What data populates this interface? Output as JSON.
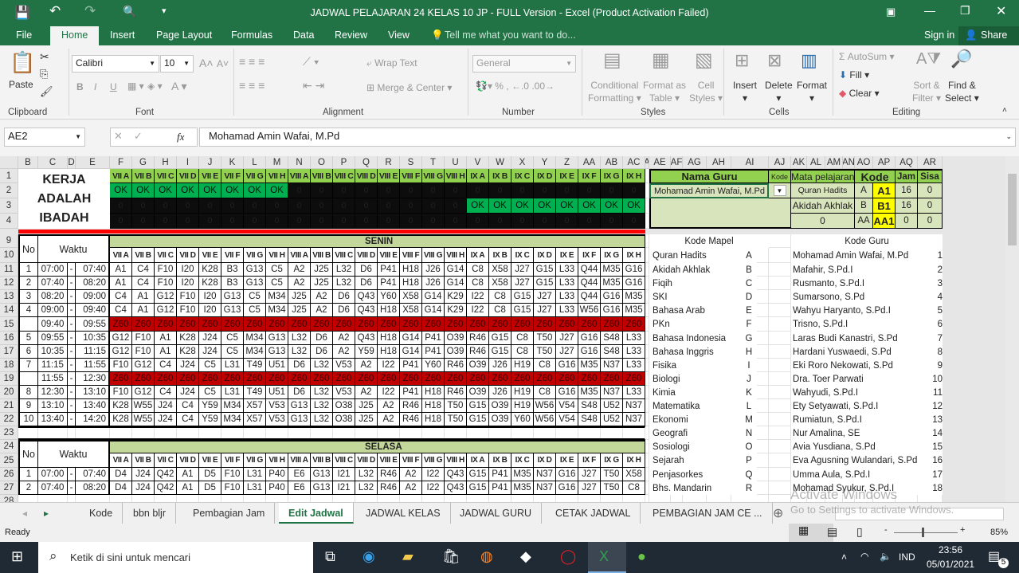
{
  "window": {
    "title": "JADWAL PELAJARAN 24 KELAS 10 JP - FULL Version - Excel (Product Activation Failed)"
  },
  "ribbon_tabs": {
    "file": "File",
    "home": "Home",
    "insert": "Insert",
    "page_layout": "Page Layout",
    "formulas": "Formulas",
    "data": "Data",
    "review": "Review",
    "view": "View",
    "tell_me": "Tell me what you want to do...",
    "sign_in": "Sign in",
    "share": "Share",
    "active": "Home"
  },
  "ribbon": {
    "clipboard": {
      "label": "Clipboard",
      "paste": "Paste"
    },
    "font": {
      "label": "Font",
      "name": "Calibri",
      "size": "10",
      "bold": "B",
      "italic": "I",
      "underline": "U"
    },
    "alignment": {
      "label": "Alignment",
      "wrap_text": "Wrap Text",
      "merge_center": "Merge & Center"
    },
    "number": {
      "label": "Number",
      "format": "General"
    },
    "styles": {
      "label": "Styles",
      "conditional": "Conditional",
      "formatting": "Formatting",
      "format_as": "Format as",
      "table": "Table",
      "cell": "Cell",
      "styles": "Styles"
    },
    "cells": {
      "label": "Cells",
      "insert": "Insert",
      "delete": "Delete",
      "format": "Format"
    },
    "editing": {
      "label": "Editing",
      "autosum": "AutoSum",
      "fill": "Fill",
      "clear": "Clear",
      "sort": "Sort &",
      "filter": "Filter",
      "find": "Find &",
      "select": "Select"
    }
  },
  "formula_bar": {
    "name_box": "AE2",
    "fx": "fx",
    "value": "Mohamad Amin Wafai, M.Pd"
  },
  "column_headers": [
    "B",
    "C",
    "D",
    "E",
    "F",
    "G",
    "H",
    "I",
    "J",
    "K",
    "L",
    "M",
    "N",
    "O",
    "P",
    "Q",
    "R",
    "S",
    "T",
    "U",
    "V",
    "W",
    "X",
    "Y",
    "Z",
    "AA",
    "AB",
    "AC",
    "A",
    "AE",
    "AF",
    "AG",
    "AH",
    "AI",
    "AJ",
    "AK",
    "AL",
    "AM",
    "AN",
    "AO",
    "AP",
    "AQ",
    "AR"
  ],
  "row_headers": [
    "1",
    "2",
    "3",
    "4",
    "9",
    "10",
    "11",
    "12",
    "13",
    "14",
    "15",
    "16",
    "17",
    "18",
    "19",
    "20",
    "21",
    "22",
    "23",
    "24",
    "25",
    "26",
    "27",
    "28"
  ],
  "motto": [
    "KERJA",
    "ADALAH",
    "IBADAH"
  ],
  "classes": [
    "VII A",
    "VII B",
    "VII C",
    "VII D",
    "VII E",
    "VII F",
    "VII G",
    "VII H",
    "VIII A",
    "VIII B",
    "VIII C",
    "VIII D",
    "VIII E",
    "VIII F",
    "VIII G",
    "VIII H",
    "IX A",
    "IX B",
    "IX C",
    "IX D",
    "IX E",
    "IX F",
    "IX G",
    "IX H"
  ],
  "status_rows": [
    [
      "OK",
      "OK",
      "OK",
      "OK",
      "OK",
      "OK",
      "OK",
      "OK",
      "0",
      "0",
      "0",
      "0",
      "0",
      "0",
      "0",
      "0",
      "0",
      "0",
      "0",
      "0",
      "0",
      "0",
      "0",
      "0"
    ],
    [
      "0",
      "0",
      "0",
      "0",
      "0",
      "0",
      "0",
      "0",
      "0",
      "0",
      "0",
      "0",
      "0",
      "0",
      "0",
      "0",
      "OK",
      "OK",
      "OK",
      "OK",
      "OK",
      "OK",
      "OK",
      "OK"
    ],
    [
      "0",
      "0",
      "0",
      "0",
      "0",
      "0",
      "0",
      "0",
      "0",
      "0",
      "0",
      "0",
      "0",
      "0",
      "0",
      "0",
      "0",
      "0",
      "0",
      "0",
      "0",
      "0",
      "0",
      "0"
    ]
  ],
  "colors": {
    "header_green": "#92d050",
    "ok_green": "#00b050",
    "black": "#0d0d0d",
    "day_band": "#c4d79b",
    "break_red": "#c00000",
    "panel_green": "#d8e4bc",
    "code_yellow": "#ffff00",
    "excel_green": "#217346"
  },
  "labels": {
    "no": "No",
    "waktu": "Waktu",
    "dash": "-"
  },
  "senin": {
    "day": "SENIN",
    "rows": [
      {
        "no": "1",
        "start": "07:00",
        "end": "07:40",
        "cells": [
          "A1",
          "C4",
          "F10",
          "I20",
          "K28",
          "B3",
          "G13",
          "C5",
          "A2",
          "J25",
          "L32",
          "D6",
          "P41",
          "H18",
          "J26",
          "G14",
          "C8",
          "X58",
          "J27",
          "G15",
          "L33",
          "Q44",
          "M35",
          "G16"
        ]
      },
      {
        "no": "2",
        "start": "07:40",
        "end": "08:20",
        "cells": [
          "A1",
          "C4",
          "F10",
          "I20",
          "K28",
          "B3",
          "G13",
          "C5",
          "A2",
          "J25",
          "L32",
          "D6",
          "P41",
          "H18",
          "J26",
          "G14",
          "C8",
          "X58",
          "J27",
          "G15",
          "L33",
          "Q44",
          "M35",
          "G16"
        ]
      },
      {
        "no": "3",
        "start": "08:20",
        "end": "09:00",
        "cells": [
          "C4",
          "A1",
          "G12",
          "F10",
          "I20",
          "G13",
          "C5",
          "M34",
          "J25",
          "A2",
          "D6",
          "Q43",
          "Y60",
          "X58",
          "G14",
          "K29",
          "I22",
          "C8",
          "G15",
          "J27",
          "L33",
          "Q44",
          "G16",
          "M35"
        ]
      },
      {
        "no": "4",
        "start": "09:00",
        "end": "09:40",
        "cells": [
          "C4",
          "A1",
          "G12",
          "F10",
          "I20",
          "G13",
          "C5",
          "M34",
          "J25",
          "A2",
          "D6",
          "Q43",
          "H18",
          "X58",
          "G14",
          "K29",
          "I22",
          "C8",
          "G15",
          "J27",
          "L33",
          "W56",
          "G16",
          "M35"
        ]
      },
      {
        "no": "",
        "start": "09:40",
        "end": "09:55",
        "break": true,
        "cells": [
          "Z60",
          "Z60",
          "Z60",
          "Z60",
          "Z60",
          "Z60",
          "Z60",
          "Z60",
          "Z60",
          "Z60",
          "Z60",
          "Z60",
          "Z60",
          "Z60",
          "Z60",
          "Z60",
          "Z60",
          "Z60",
          "Z60",
          "Z60",
          "Z60",
          "Z60",
          "Z60",
          "Z60"
        ]
      },
      {
        "no": "5",
        "start": "09:55",
        "end": "10:35",
        "cells": [
          "G12",
          "F10",
          "A1",
          "K28",
          "J24",
          "C5",
          "M34",
          "G13",
          "L32",
          "D6",
          "A2",
          "Q43",
          "H18",
          "G14",
          "P41",
          "O39",
          "R46",
          "G15",
          "C8",
          "T50",
          "J27",
          "G16",
          "S48",
          "L33"
        ]
      },
      {
        "no": "6",
        "start": "10:35",
        "end": "11:15",
        "cells": [
          "G12",
          "F10",
          "A1",
          "K28",
          "J24",
          "C5",
          "M34",
          "G13",
          "L32",
          "D6",
          "A2",
          "Y59",
          "H18",
          "G14",
          "P41",
          "O39",
          "R46",
          "G15",
          "C8",
          "T50",
          "J27",
          "G16",
          "S48",
          "L33"
        ]
      },
      {
        "no": "7",
        "start": "11:15",
        "end": "11:55",
        "cells": [
          "F10",
          "G12",
          "C4",
          "J24",
          "C5",
          "L31",
          "T49",
          "U51",
          "D6",
          "L32",
          "V53",
          "A2",
          "I22",
          "P41",
          "Y60",
          "R46",
          "O39",
          "J26",
          "H19",
          "C8",
          "G16",
          "M35",
          "N37",
          "L33"
        ]
      },
      {
        "no": "",
        "start": "11:55",
        "end": "12:30",
        "break": true,
        "cells": [
          "Z60",
          "Z60",
          "Z60",
          "Z60",
          "Z60",
          "Z60",
          "Z60",
          "Z60",
          "Z60",
          "Z60",
          "Z60",
          "Z60",
          "Z60",
          "Z60",
          "Z60",
          "Z60",
          "Z60",
          "Z60",
          "Z60",
          "Z60",
          "Z60",
          "Z60",
          "Z60",
          "Z60"
        ]
      },
      {
        "no": "8",
        "start": "12:30",
        "end": "13:10",
        "cells": [
          "F10",
          "G12",
          "C4",
          "J24",
          "C5",
          "L31",
          "T49",
          "U51",
          "D6",
          "L32",
          "V53",
          "A2",
          "I22",
          "P41",
          "H18",
          "R46",
          "O39",
          "J26",
          "H19",
          "C8",
          "G16",
          "M35",
          "N37",
          "L33"
        ]
      },
      {
        "no": "9",
        "start": "13:10",
        "end": "13:40",
        "cells": [
          "K28",
          "W55",
          "J24",
          "C4",
          "Y59",
          "M34",
          "X57",
          "V53",
          "G13",
          "L32",
          "O38",
          "J25",
          "A2",
          "R46",
          "H18",
          "T50",
          "G15",
          "O39",
          "H19",
          "W56",
          "V54",
          "S48",
          "U52",
          "N37"
        ]
      },
      {
        "no": "10",
        "start": "13:40",
        "end": "14:20",
        "cells": [
          "K28",
          "W55",
          "J24",
          "C4",
          "Y59",
          "M34",
          "X57",
          "V53",
          "G13",
          "L32",
          "O38",
          "J25",
          "A2",
          "R46",
          "H18",
          "T50",
          "G15",
          "O39",
          "Y60",
          "W56",
          "V54",
          "S48",
          "U52",
          "N37"
        ]
      }
    ]
  },
  "selasa": {
    "day": "SELASA",
    "rows": [
      {
        "no": "1",
        "start": "07:00",
        "end": "07:40",
        "cells": [
          "D4",
          "J24",
          "Q42",
          "A1",
          "D5",
          "F10",
          "L31",
          "P40",
          "E6",
          "G13",
          "I21",
          "L32",
          "R46",
          "A2",
          "I22",
          "Q43",
          "G15",
          "P41",
          "M35",
          "N37",
          "G16",
          "J27",
          "T50",
          "X58"
        ]
      },
      {
        "no": "2",
        "start": "07:40",
        "end": "08:20",
        "cells": [
          "D4",
          "J24",
          "Q42",
          "A1",
          "D5",
          "F10",
          "L31",
          "P40",
          "E6",
          "G13",
          "I21",
          "L32",
          "R46",
          "A2",
          "I22",
          "Q43",
          "G15",
          "P41",
          "M35",
          "N37",
          "G16",
          "J27",
          "T50",
          "C8"
        ]
      }
    ]
  },
  "panel": {
    "nama_guru": "Nama Guru",
    "kode_small": "Kode",
    "mata_pelajaran": "Mata pelajaran",
    "kode": "Kode",
    "jam": "Jam",
    "sisa": "Sisa",
    "selected_guru": "Mohamad Amin Wafai, M.Pd",
    "subjects": [
      {
        "mapel": "Quran Hadits",
        "abbr": "A",
        "kode": "A1",
        "jam": "16",
        "sisa": "0"
      },
      {
        "mapel": "Akidah Akhlak",
        "abbr": "B",
        "kode": "B1",
        "jam": "16",
        "sisa": "0"
      },
      {
        "mapel": "0",
        "abbr": "AA",
        "kode": "AA1",
        "jam": "0",
        "sisa": "0"
      }
    ]
  },
  "kode_mapel": {
    "title": "Kode Mapel",
    "items": [
      [
        "Quran Hadits",
        "A"
      ],
      [
        "Akidah Akhlak",
        "B"
      ],
      [
        "Fiqih",
        "C"
      ],
      [
        "SKI",
        "D"
      ],
      [
        "Bahasa Arab",
        "E"
      ],
      [
        "PKn",
        "F"
      ],
      [
        "Bahasa Indonesia",
        "G"
      ],
      [
        "Bahasa Inggris",
        "H"
      ],
      [
        "Fisika",
        "I"
      ],
      [
        "Biologi",
        "J"
      ],
      [
        "Kimia",
        "K"
      ],
      [
        "Matematika",
        "L"
      ],
      [
        "Ekonomi",
        "M"
      ],
      [
        "Geografi",
        "N"
      ],
      [
        "Sosiologi",
        "O"
      ],
      [
        "Sejarah",
        "P"
      ],
      [
        "Penjasorkes",
        "Q"
      ],
      [
        "Bhs.  Mandarin",
        "R"
      ]
    ]
  },
  "kode_guru": {
    "title": "Kode Guru",
    "items": [
      [
        "Mohamad Amin Wafai, M.Pd",
        "1"
      ],
      [
        "Mafahir, S.Pd.I",
        "2"
      ],
      [
        "Rusmanto, S.Pd.I",
        "3"
      ],
      [
        "Sumarsono, S.Pd",
        "4"
      ],
      [
        "Wahyu Haryanto, S.Pd.I",
        "5"
      ],
      [
        "Trisno, S.Pd.I",
        "6"
      ],
      [
        "Laras Budi Kanastri, S.Pd",
        "7"
      ],
      [
        "Hardani Yuswaedi, S.Pd",
        "8"
      ],
      [
        "Eki Roro Nekowati, S.Pd",
        "9"
      ],
      [
        "Dra. Toer Parwati",
        "10"
      ],
      [
        "Wahyudi, S.Pd.I",
        "11"
      ],
      [
        "Ety Setyawati, S.Pd.I",
        "12"
      ],
      [
        "Rumiatun, S.Pd.I",
        "13"
      ],
      [
        "Nur Amalina, SE",
        "14"
      ],
      [
        "Avia Yusdiana, S.Pd",
        "15"
      ],
      [
        "Eva Agusning Wulandari, S.Pd",
        "16"
      ],
      [
        "Umma Aula, S.Pd.I",
        "17"
      ],
      [
        "Mohamad Syukur, S.Pd.I",
        "18"
      ]
    ]
  },
  "sheet_tabs": [
    "Kode",
    "bbn bljr",
    "Pembagian Jam",
    "Edit Jadwal",
    "JADWAL KELAS",
    "JADWAL GURU",
    "CETAK JADWAL",
    "PEMBAGIAN JAM CE ..."
  ],
  "active_sheet": "Edit Jadwal",
  "watermark": {
    "line1": "Activate Windows",
    "line2": "Go to Settings to activate Windows."
  },
  "status": {
    "ready": "Ready",
    "zoom": "85%"
  },
  "taskbar": {
    "search": "Ketik di sini untuk mencari",
    "lang": "IND",
    "time": "23:56",
    "date": "05/01/2021",
    "notifications": "5"
  }
}
